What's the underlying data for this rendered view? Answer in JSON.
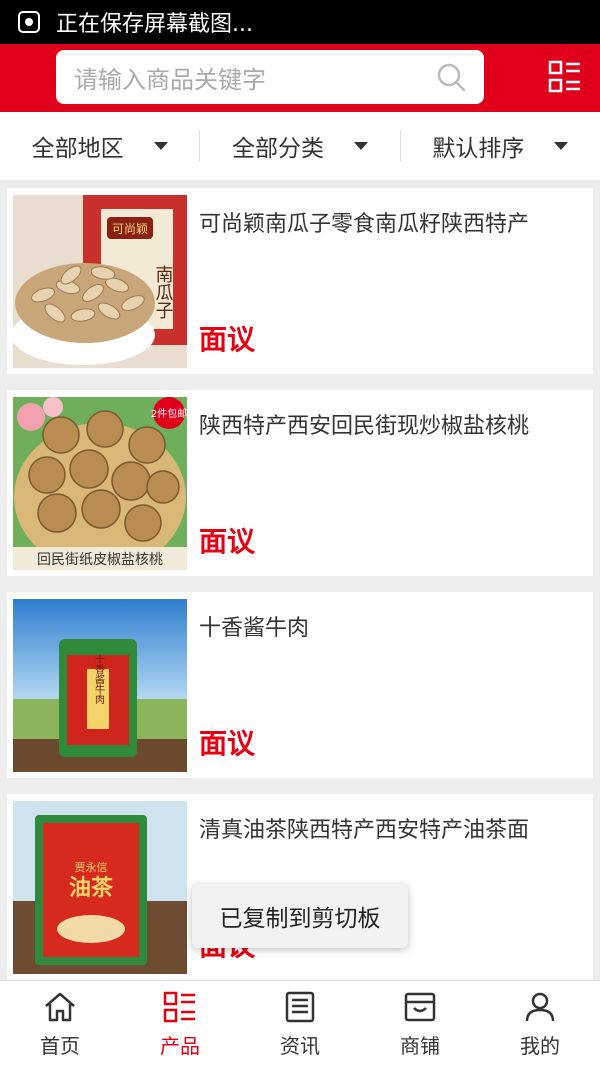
{
  "status": {
    "text": "正在保存屏幕截图..."
  },
  "search": {
    "placeholder": "请输入商品关键字"
  },
  "filters": [
    {
      "label": "全部地区"
    },
    {
      "label": "全部分类"
    },
    {
      "label": "默认排序"
    }
  ],
  "products": [
    {
      "title": "可尚颖南瓜子零食南瓜籽陕西特产",
      "price": "面议",
      "image_labels": {
        "brand": "可尚颖",
        "side": "南瓜子"
      }
    },
    {
      "title": "陕西特产西安回民街现炒椒盐核桃",
      "price": "面议",
      "image_labels": {
        "badge": "2件包邮",
        "caption": "回民街纸皮椒盐核桃"
      }
    },
    {
      "title": "十香酱牛肉",
      "price": "面议",
      "image_labels": {
        "pack": "十香酱牛肉"
      }
    },
    {
      "title": "清真油茶陕西特产西安特产油茶面",
      "price": "面议",
      "image_labels": {
        "pack": "油茶",
        "brand": "贾永信"
      }
    }
  ],
  "toast": {
    "text": "已复制到剪切板"
  },
  "tabs": [
    {
      "label": "首页",
      "icon": "home-icon"
    },
    {
      "label": "产品",
      "icon": "list-icon",
      "active": true
    },
    {
      "label": "资讯",
      "icon": "news-icon"
    },
    {
      "label": "商铺",
      "icon": "shop-icon"
    },
    {
      "label": "我的",
      "icon": "user-icon"
    }
  ],
  "colors": {
    "brand_red": "#e0001b",
    "price_red": "#e60012"
  }
}
